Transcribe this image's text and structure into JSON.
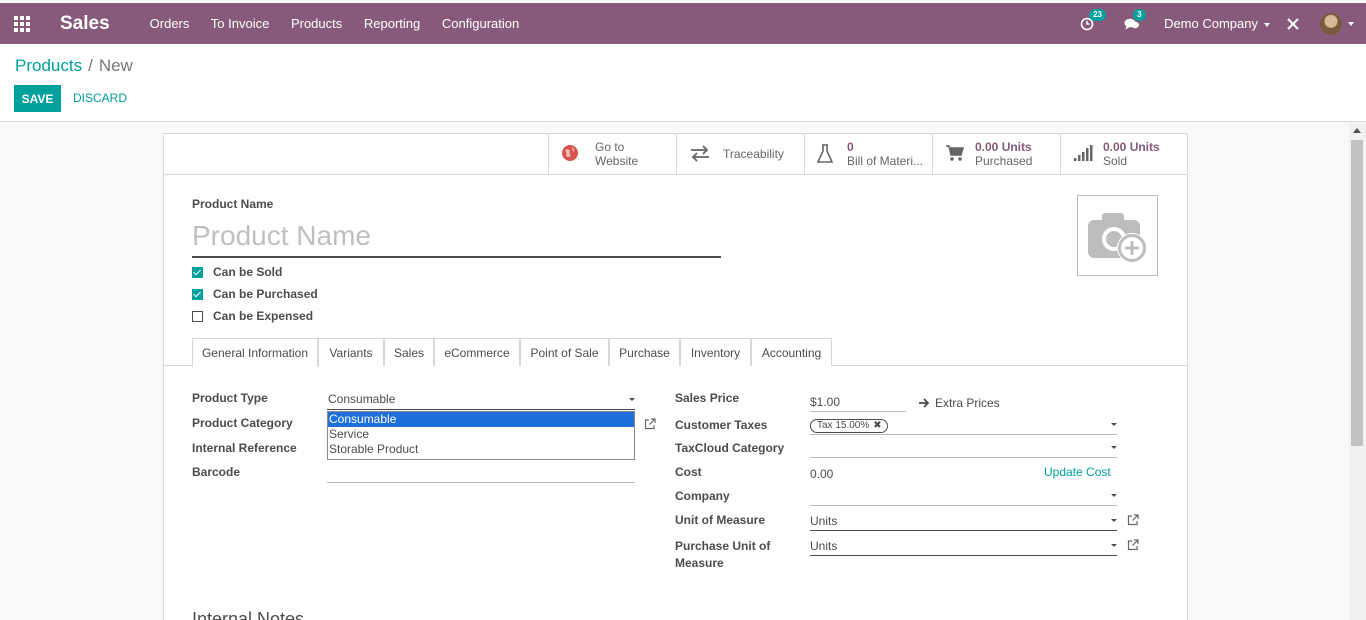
{
  "navbar": {
    "app_name": "Sales",
    "menu": [
      "Orders",
      "To Invoice",
      "Products",
      "Reporting",
      "Configuration"
    ],
    "activity_count": "23",
    "message_count": "3",
    "company": "Demo Company"
  },
  "breadcrumb": {
    "parent": "Products",
    "separator": "/",
    "current": "New"
  },
  "actions": {
    "save": "SAVE",
    "discard": "DISCARD"
  },
  "smart_buttons": {
    "website": {
      "line1": "Go to",
      "line2": "Website"
    },
    "traceability": {
      "label": "Traceability"
    },
    "bom": {
      "value": "0",
      "label": "Bill of Materi..."
    },
    "purchased": {
      "value": "0.00 Units",
      "label": "Purchased"
    },
    "sold": {
      "value": "0.00 Units",
      "label": "Sold"
    }
  },
  "product": {
    "name_label": "Product Name",
    "name_placeholder": "Product Name",
    "can_be_sold": "Can be Sold",
    "can_be_purchased": "Can be Purchased",
    "can_be_expensed": "Can be Expensed"
  },
  "tabs": [
    "General Information",
    "Variants",
    "Sales",
    "eCommerce",
    "Point of Sale",
    "Purchase",
    "Inventory",
    "Accounting"
  ],
  "general": {
    "product_type_label": "Product Type",
    "product_type_value": "Consumable",
    "product_category_label": "Product Category",
    "internal_reference_label": "Internal Reference",
    "barcode_label": "Barcode",
    "type_options": [
      "Consumable",
      "Service",
      "Storable Product"
    ],
    "sales_price_label": "Sales Price",
    "sales_price_value": "$1.00",
    "extra_prices": "Extra Prices",
    "customer_taxes_label": "Customer Taxes",
    "tax_tag": "Tax 15.00%",
    "taxcloud_label": "TaxCloud Category",
    "cost_label": "Cost",
    "cost_value": "0.00",
    "update_cost": "Update Cost",
    "company_label": "Company",
    "uom_label": "Unit of Measure",
    "uom_value": "Units",
    "purchase_uom_label_1": "Purchase Unit of",
    "purchase_uom_label_2": "Measure",
    "purchase_uom_value": "Units"
  },
  "notes_title": "Internal Notes"
}
